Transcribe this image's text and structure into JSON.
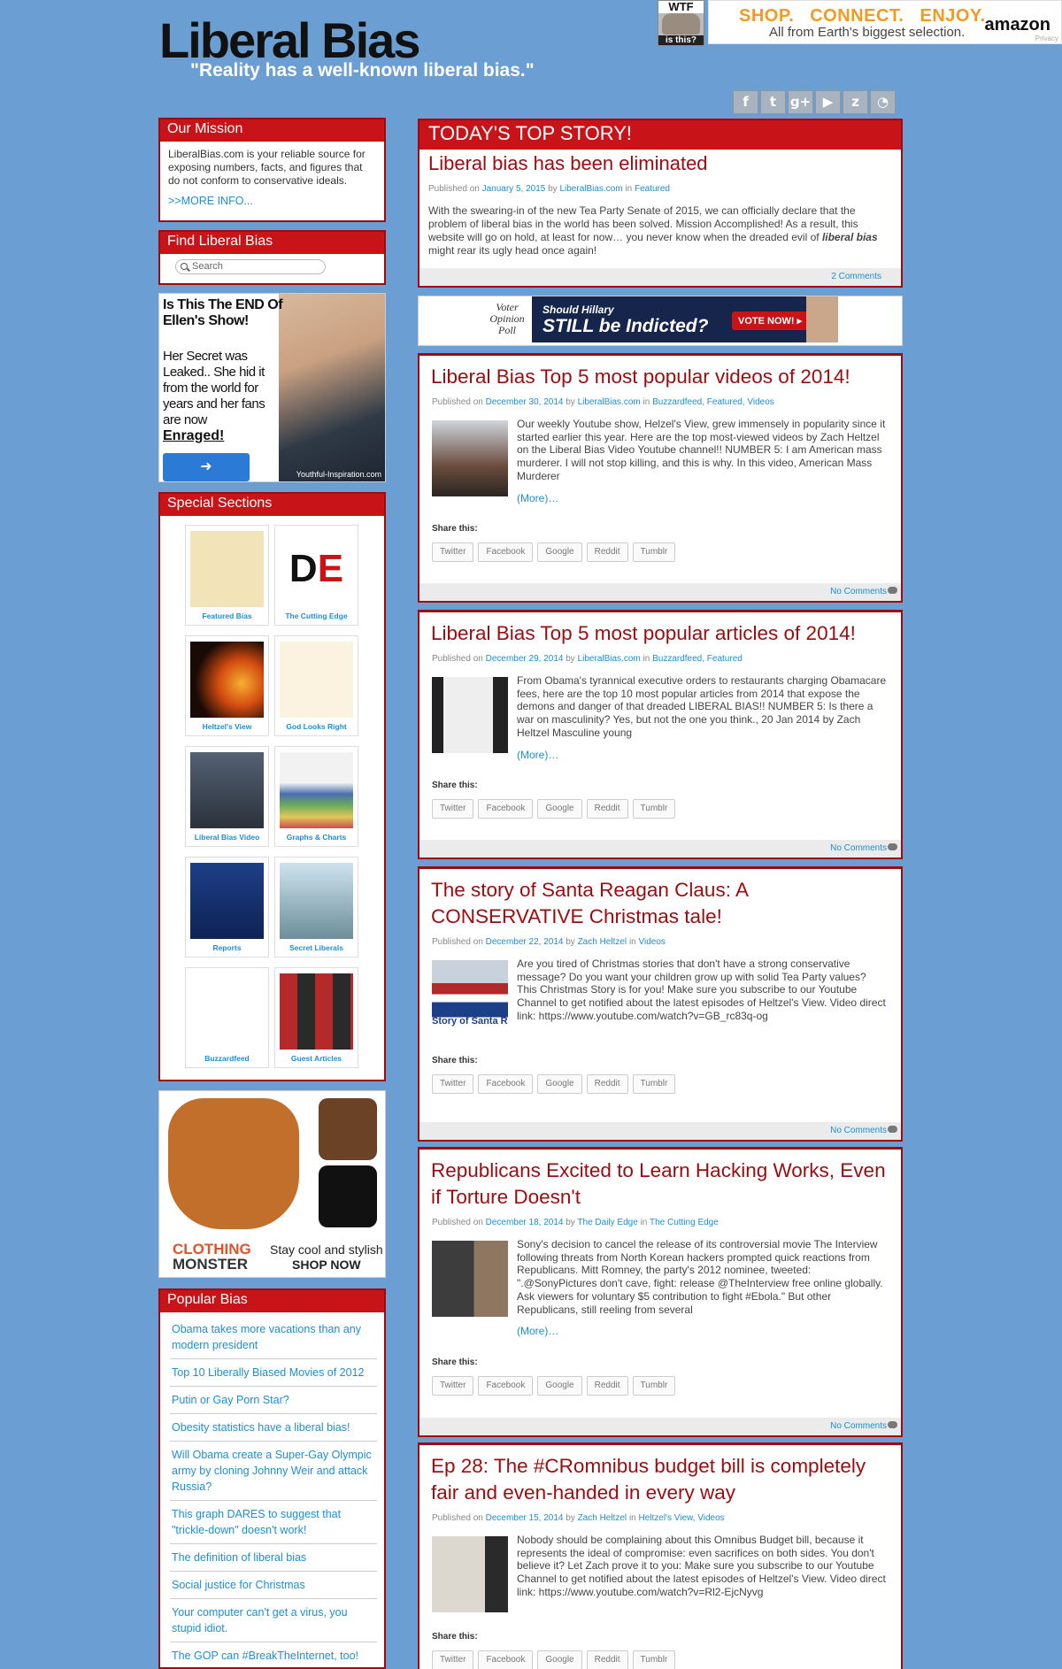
{
  "header": {
    "logo": "Liberal Bias",
    "tagline": "\"Reality has a well-known liberal bias.\""
  },
  "wtf_ad": {
    "top": "WTF",
    "bottom": "is this?"
  },
  "amazon_ad": {
    "headline": "SHOP. CONNECT. ENJOY.",
    "subline": "All from Earth's biggest selection.",
    "brand": "amazon",
    "privacy": "Privacy"
  },
  "social_icons": [
    "facebook-icon",
    "twitter-icon",
    "google-plus-icon",
    "youtube-icon",
    "zemanta-icon",
    "rss-icon"
  ],
  "sidebar": {
    "mission": {
      "heading": "Our Mission",
      "text": "LiberalBias.com is your reliable source for exposing numbers, facts, and figures that do not conform to conservative ideals.",
      "more": ">>MORE INFO..."
    },
    "find": {
      "heading": "Find Liberal Bias",
      "placeholder": "Search"
    },
    "ad_ellen": {
      "headline": "Is This The END Of Ellen's Show!",
      "body": "Her Secret was Leaked.. She hid it from the world for years and her fans are now",
      "emph": "Enraged!",
      "credit": "Youthful-Inspiration.com"
    },
    "special": {
      "heading": "Special Sections",
      "tiles": [
        "Featured Bias",
        "The Cutting Edge",
        "Heltzel's View",
        "God Looks Right",
        "Liberal Bias Video",
        "Graphs & Charts",
        "Reports",
        "Secret Liberals",
        "Buzzardfeed",
        "Guest Articles"
      ]
    },
    "ad_clothing": {
      "brand1": "CLOTHING",
      "brand2": "MONSTER",
      "line1": "Stay cool and stylish",
      "line2": "SHOP NOW"
    },
    "popular": {
      "heading": "Popular Bias",
      "items": [
        "Obama takes more vacations than any modern president",
        "Top 10 Liberally Biased Movies of 2012",
        "Putin or Gay Porn Star?",
        "Obesity statistics have a liberal bias!",
        "Will Obama create a Super-Gay Olympic army by cloning Johnny Weir and attack Russia?",
        "This graph DARES to suggest that \"trickle-down\" doesn't work!",
        "The definition of liberal bias",
        "Social justice for Christmas",
        "Your computer can't get a virus, you stupid idiot.",
        "The GOP can #BreakTheInternet, too!"
      ]
    }
  },
  "top_story": {
    "heading": "TODAY'S TOP STORY!",
    "title": "Liberal bias has been eliminated",
    "published": "Published on",
    "date": "January 5, 2015",
    "by": "by",
    "author": "LiberalBias.com",
    "in": "in",
    "cats": "Featured",
    "text": "With the swearing-in of the new Tea Party Senate of 2015, we can officially declare that the problem of liberal bias in the world has been solved. Mission Accomplished! As a result, this website will go on hold, at least for now… you never know when the dreaded evil of",
    "emph": "liberal bias",
    "tail": "might rear its ugly head once again!",
    "comments": "2 Comments"
  },
  "ad_hillary": {
    "poll": "Voter Opinion Poll",
    "q1": "Should Hillary",
    "q2": "STILL be Indicted?",
    "vote": "VOTE NOW! ▸"
  },
  "share": {
    "label": "Share this:",
    "buttons": [
      "Twitter",
      "Facebook",
      "Google",
      "Reddit",
      "Tumblr"
    ]
  },
  "posts": [
    {
      "title": "Liberal Bias Top 5 most popular videos of 2014!",
      "date": "December 30, 2014",
      "author": "LiberalBias.com",
      "cats": "Buzzardfeed, Featured, Videos",
      "text": "Our weekly Youtube show, Helzel's View, grew immensely in popularity since it started earlier this year. Here are the top most-viewed videos by Zach Heltzel on the Liberal Bias Video Youtube channel!! NUMBER 5: I am American mass murderer. I will not stop killing, and this is why. In this video, American Mass Murderer",
      "more": "(More)…",
      "comments": "No Comments"
    },
    {
      "title": "Liberal Bias Top 5 most popular articles of 2014!",
      "date": "December 29, 2014",
      "author": "LiberalBias.com",
      "cats": "Buzzardfeed, Featured",
      "text": "From Obama's tyrannical executive orders to restaurants charging Obamacare fees, here are the top 10 most popular articles from 2014 that expose the demons and danger of that dreaded LIBERAL BIAS!! NUMBER 5: Is there a war on masculinity? Yes, but not the one you think., 20 Jan 2014 by Zach Heltzel Masculine young",
      "more": "(More)…",
      "comments": "No Comments"
    },
    {
      "title": "The story of Santa Reagan Claus: A CONSERVATIVE Christmas tale!",
      "date": "December 22, 2014",
      "author": "Zach Heltzel",
      "cats": "Videos",
      "text": "Are you tired of Christmas stories that don't have a strong conservative message? Do you want your children grow up with solid Tea Party values? This Christmas Story is for you! Make sure you subscribe to our Youtube Channel to get notified about the latest episodes of Heltzel's View. Video direct link: https://www.youtube.com/watch?v=GB_rc83q-og",
      "more": "",
      "thumb_text": "Story of Santa R. C",
      "comments": "No Comments"
    },
    {
      "title": "Republicans Excited to Learn Hacking Works, Even if Torture Doesn't",
      "date": "December 18, 2014",
      "author": "The Daily Edge",
      "cats": "The Cutting Edge",
      "text": "Sony's decision to cancel the release of its controversial movie The Interview following threats from North Korean hackers prompted quick reactions from Republicans. Mitt Romney, the party's 2012 nominee, tweeted: \".@SonyPictures don't cave, fight: release @TheInterview free online globally. Ask viewers for voluntary $5 contribution to fight #Ebola.\" But other Republicans, still reeling from several",
      "more": "(More)…",
      "comments": "No Comments"
    },
    {
      "title": "Ep 28: The #CRomnibus budget bill is completely fair and even-handed in every way",
      "date": "December 15, 2014",
      "author": "Zach Heltzel",
      "cats": "Heltzel's View, Videos",
      "text": "Nobody should be complaining about this Omnibus Budget bill, because it represents the ideal of compromise: even sacrifices on both sides. You don't believe it? Let Zach prove it to you: Make sure you subscribe to our Youtube Channel to get notified about the latest episodes of Heltzel's View. Video direct link: https://www.youtube.com/watch?v=Rl2-EjcNyvg",
      "more": "",
      "comments": ""
    }
  ],
  "colors": {
    "background": "#6b9fd3",
    "header_red": "#c81419",
    "title_red": "#9e0b0f",
    "link_blue": "#1c8fd6"
  }
}
